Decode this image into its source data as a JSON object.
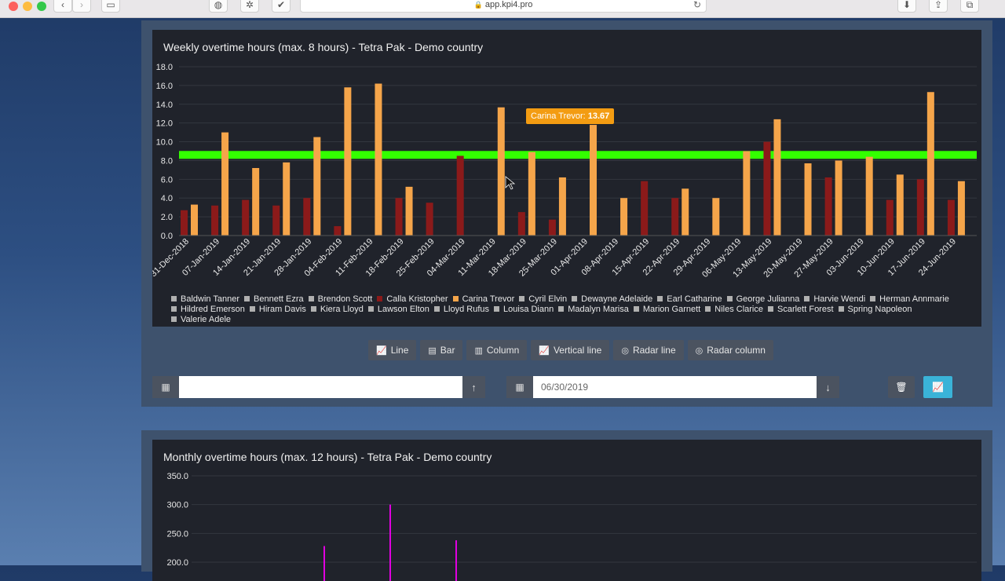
{
  "browser": {
    "url": "app.kpi4.pro"
  },
  "weekly": {
    "title": "Weekly overtime hours (max. 8 hours) - Tetra Pak - Demo country",
    "tooltip": {
      "name": "Carina Trevor:",
      "value": "13.67"
    },
    "buttons": [
      {
        "id": "line",
        "label": "Line",
        "icon": "line-chart-icon"
      },
      {
        "id": "bar",
        "label": "Bar",
        "icon": "bar-chart-icon"
      },
      {
        "id": "column",
        "label": "Column",
        "icon": "column-chart-icon"
      },
      {
        "id": "vertical-line",
        "label": "Vertical line",
        "icon": "line-chart-icon"
      },
      {
        "id": "radar-line",
        "label": "Radar line",
        "icon": "radar-icon"
      },
      {
        "id": "radar-column",
        "label": "Radar column",
        "icon": "radar-icon"
      }
    ],
    "start_date": {
      "value": "",
      "placeholder": ""
    },
    "end_date": {
      "value": "06/30/2019",
      "placeholder": ""
    }
  },
  "monthly": {
    "title": "Monthly overtime hours (max. 12 hours) - Tetra Pak - Demo country"
  },
  "colors": {
    "calla": "#8b1a1a",
    "carina": "#f5a54a",
    "limit": "#33ff00",
    "inactive": "#b0b0b0",
    "magenta": "#e000e0",
    "chart_bg": "#20232b",
    "accent": "#3ab3d8"
  },
  "chart_data": [
    {
      "type": "bar",
      "title": "Weekly overtime hours (max. 8 hours) - Tetra Pak - Demo country",
      "categories": [
        "31-Dec-2018",
        "07-Jan-2019",
        "14-Jan-2019",
        "21-Jan-2019",
        "28-Jan-2019",
        "04-Feb-2019",
        "11-Feb-2019",
        "18-Feb-2019",
        "25-Feb-2019",
        "04-Mar-2019",
        "11-Mar-2019",
        "18-Mar-2019",
        "25-Mar-2019",
        "01-Apr-2019",
        "08-Apr-2019",
        "15-Apr-2019",
        "22-Apr-2019",
        "29-Apr-2019",
        "06-May-2019",
        "13-May-2019",
        "20-May-2019",
        "27-May-2019",
        "03-Jun-2019",
        "10-Jun-2019",
        "17-Jun-2019",
        "24-Jun-2019"
      ],
      "series": [
        {
          "name": "Calla Kristopher",
          "values": [
            2.7,
            3.2,
            3.8,
            3.2,
            4.0,
            1.0,
            0,
            4.0,
            3.5,
            8.5,
            0,
            2.5,
            1.7,
            0,
            0,
            5.8,
            4.0,
            0,
            0,
            10.0,
            0,
            6.2,
            0,
            3.8,
            6.0,
            3.8
          ]
        },
        {
          "name": "Carina Trevor",
          "values": [
            3.3,
            11.0,
            7.2,
            7.8,
            10.5,
            15.8,
            16.2,
            5.2,
            0,
            0,
            13.67,
            8.9,
            6.2,
            11.8,
            4.0,
            0,
            5.0,
            4.0,
            9.0,
            12.4,
            7.7,
            8.0,
            8.4,
            6.5,
            15.3,
            5.8
          ]
        }
      ],
      "reference_line": 8.6,
      "ylim": [
        0,
        18
      ],
      "yticks": [
        "0.0",
        "2.0",
        "4.0",
        "6.0",
        "8.0",
        "10.0",
        "12.0",
        "14.0",
        "16.0",
        "18.0"
      ],
      "legend": [
        "Baldwin Tanner",
        "Bennett Ezra",
        "Brendon Scott",
        "Calla Kristopher",
        "Carina Trevor",
        "Cyril Elvin",
        "Dewayne Adelaide",
        "Earl Catharine",
        "George Julianna",
        "Harvie Wendi",
        "Herman Annmarie",
        "Hildred Emerson",
        "Hiram Davis",
        "Kiera Lloyd",
        "Lawson Elton",
        "Lloyd Rufus",
        "Louisa Diann",
        "Madalyn Marisa",
        "Marion Garnett",
        "Niles Clarice",
        "Scarlett Forest",
        "Spring Napoleon",
        "Valerie Adele"
      ],
      "legend_active": [
        "Calla Kristopher",
        "Carina Trevor"
      ],
      "legend_placement": "bottom",
      "grid": true
    },
    {
      "type": "bar",
      "title": "Monthly overtime hours (max. 12 hours) - Tetra Pak - Demo country",
      "ylim": [
        200,
        350
      ],
      "yticks": [
        "350.0",
        "300.0",
        "250.0",
        "200.0"
      ],
      "bars": [
        {
          "value": 228
        },
        {
          "value": 300
        },
        {
          "value": 238
        }
      ],
      "grid": true
    }
  ]
}
